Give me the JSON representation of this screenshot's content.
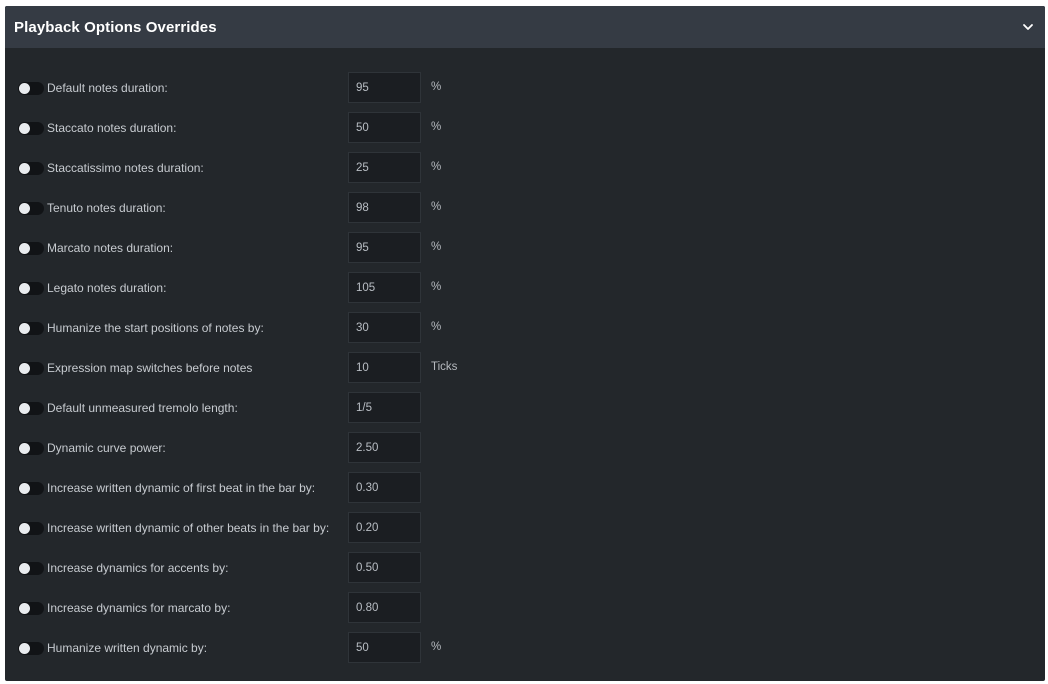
{
  "header": {
    "title": "Playback Options Overrides",
    "chevron_icon": "chevron-down-icon"
  },
  "rows": [
    {
      "label": "Default notes duration:",
      "value": "95",
      "unit": "%",
      "enabled": false
    },
    {
      "label": "Staccato notes duration:",
      "value": "50",
      "unit": "%",
      "enabled": false
    },
    {
      "label": "Staccatissimo notes duration:",
      "value": "25",
      "unit": "%",
      "enabled": false
    },
    {
      "label": "Tenuto notes duration:",
      "value": "98",
      "unit": "%",
      "enabled": false
    },
    {
      "label": "Marcato notes duration:",
      "value": "95",
      "unit": "%",
      "enabled": false
    },
    {
      "label": "Legato notes duration:",
      "value": "105",
      "unit": "%",
      "enabled": false
    },
    {
      "label": "Humanize the start positions of notes by:",
      "value": "30",
      "unit": "%",
      "enabled": false
    },
    {
      "label": "Expression map switches before notes",
      "value": "10",
      "unit": "Ticks",
      "enabled": false
    },
    {
      "label": "Default unmeasured tremolo length:",
      "value": "1/5",
      "unit": "",
      "enabled": false
    },
    {
      "label": "Dynamic curve power:",
      "value": "2.50",
      "unit": "",
      "enabled": false
    },
    {
      "label": "Increase written dynamic of first beat in the bar by:",
      "value": "0.30",
      "unit": "",
      "enabled": false
    },
    {
      "label": "Increase written dynamic of other beats in the bar by:",
      "value": "0.20",
      "unit": "",
      "enabled": false
    },
    {
      "label": "Increase dynamics for accents by:",
      "value": "0.50",
      "unit": "",
      "enabled": false
    },
    {
      "label": "Increase dynamics for marcato by:",
      "value": "0.80",
      "unit": "",
      "enabled": false
    },
    {
      "label": "Humanize written dynamic by:",
      "value": "50",
      "unit": "%",
      "enabled": false
    }
  ],
  "colors": {
    "panel_bg": "#23272b",
    "header_bg": "#353b44",
    "input_bg": "#1b1e22",
    "toggle_off": "#111316"
  }
}
